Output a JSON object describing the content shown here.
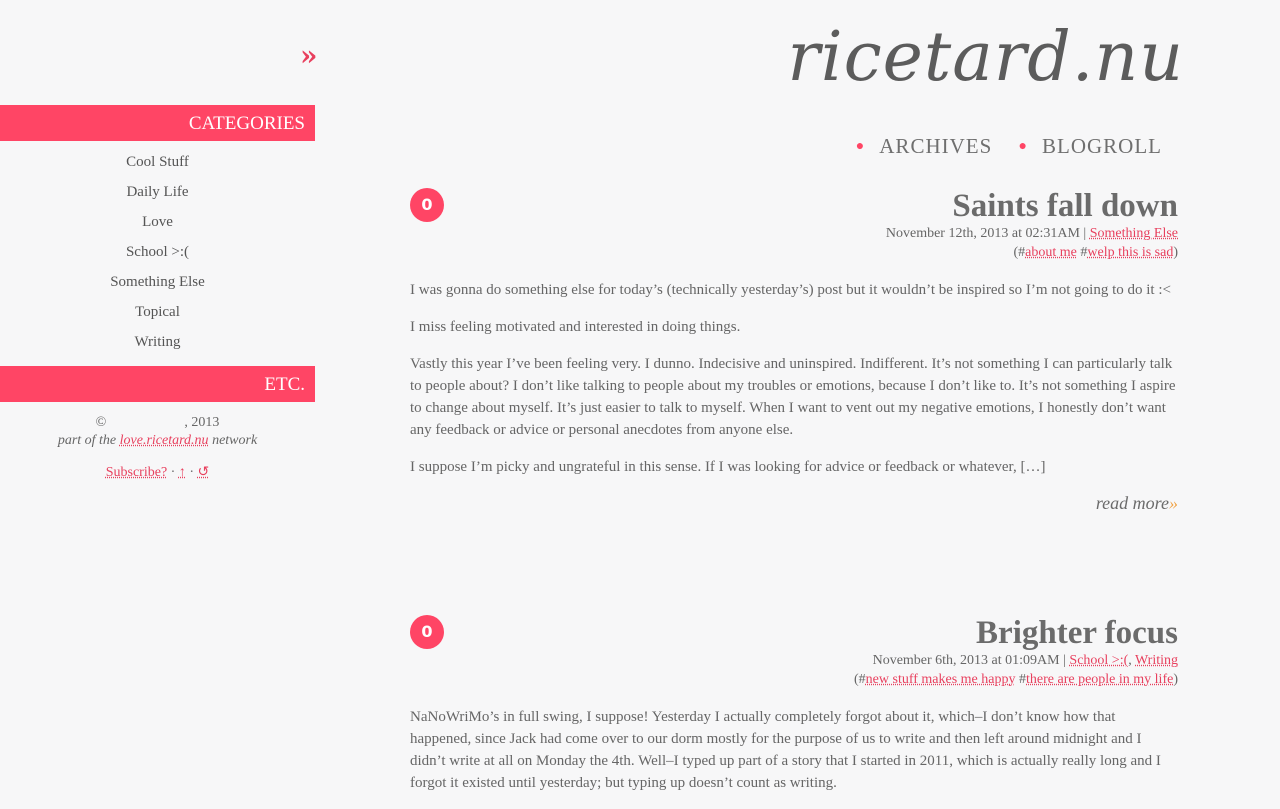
{
  "site": {
    "title": "ricetard.nu",
    "nav": [
      "ARCHIVES",
      "BLOGROLL"
    ]
  },
  "sidebar": {
    "toggle": "»",
    "categories_heading": "CATEGORIES",
    "categories": [
      "Cool Stuff",
      "Daily Life",
      "Love",
      "School >:(",
      "Something Else",
      "Topical",
      "Writing"
    ],
    "etc_heading": "ETC.",
    "copyright_symbol": "©",
    "copyright_year": ", 2013",
    "network_prefix": "part of the",
    "network_link": "love.ricetard.nu",
    "network_suffix": "network",
    "subscribe": "Subscribe?",
    "sep1": "·",
    "up": "↑",
    "sep2": "·",
    "refresh": "↺"
  },
  "posts": [
    {
      "comments": "0",
      "title": "Saints fall down",
      "date": "November 12th, 2013 at 02:31AM",
      "sep": "|",
      "categories": [
        "Something Else"
      ],
      "tags": [
        "about me",
        "welp this is sad"
      ],
      "paragraphs": [
        "I was gonna do something else for today’s (technically yesterday’s) post but it wouldn’t be inspired so I’m not going to do it :<",
        "I miss feeling motivated and interested in doing things.",
        "Vastly this year I’ve been feeling very. I dunno. Indecisive and uninspired. Indifferent. It’s not something I can particularly talk to people about? I don’t like talking to people about my troubles or emotions, because I don’t like to. It’s not something I aspire to change about myself. It’s just easier to talk to myself. When I want to vent out my negative emotions, I honestly don’t want any feedback or advice or personal anecdotes from anyone else.",
        "I suppose I’m picky and ungrateful in this sense. If I was looking for advice or feedback or whatever, […]"
      ],
      "read_more": "read more",
      "read_more_arrow": "»"
    },
    {
      "comments": "0",
      "title": "Brighter focus",
      "date": "November 6th, 2013 at 01:09AM",
      "sep": "|",
      "categories": [
        "School >:(",
        "Writing"
      ],
      "tags": [
        "new stuff makes me happy",
        "there are people in my life"
      ],
      "paragraphs": [
        "NaNoWriMo’s in full swing, I suppose! Yesterday I actually completely forgot about it, which–I don’t know how that happened, since Jack had come over to our dorm mostly for the purpose of us to write and then left around midnight and I didn’t write at all on Monday the 4th. Well–I typed up part of a story that I started in 2011, which is actually really long and I forgot it existed until yesterday; but typing up doesn’t count as writing."
      ]
    }
  ]
}
